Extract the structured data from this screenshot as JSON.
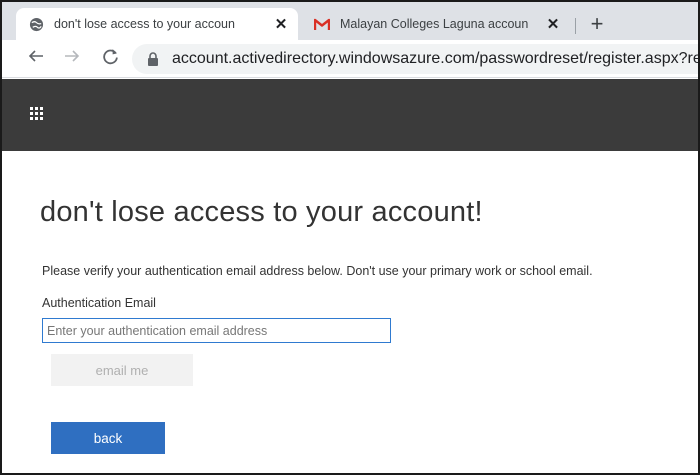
{
  "browser": {
    "tabs": [
      {
        "title": "don't lose access to your accoun",
        "icon": "globe-icon",
        "close": "✕"
      },
      {
        "title": "Malayan Colleges Laguna accoun",
        "icon": "gmail-icon",
        "close": "✕"
      }
    ],
    "new_tab": "+",
    "url": "account.activedirectory.windowsazure.com/passwordreset/register.aspx?re"
  },
  "colors": {
    "header_bg": "#3b3b3b",
    "primary_button": "#2f6fc1",
    "input_border": "#2f7ad0",
    "gmail_red": "#d93025"
  },
  "page": {
    "heading": "don't lose access to your account!",
    "instruction": "Please verify your authentication email address below. Don't use your primary work or school email.",
    "field_label": "Authentication Email",
    "email_value": "",
    "email_placeholder": "Enter your authentication email address",
    "email_me_label": "email me",
    "back_label": "back"
  }
}
